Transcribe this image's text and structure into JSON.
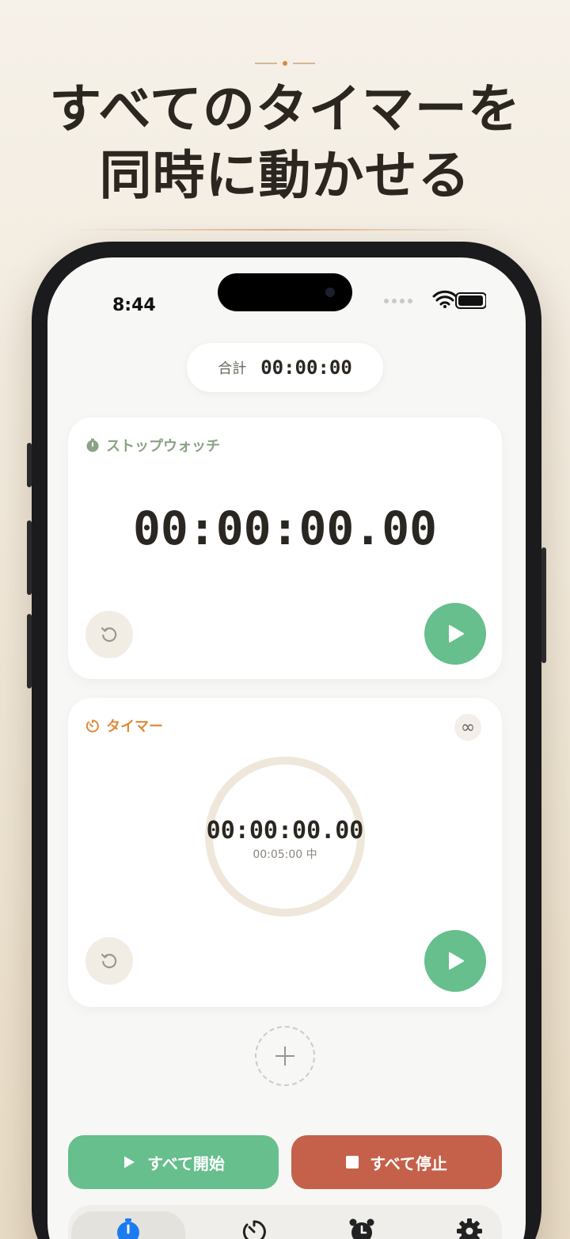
{
  "marketing": {
    "headline_line1": "すべてのタイマーを",
    "headline_line2": "同時に動かせる"
  },
  "status_bar": {
    "time": "8:44"
  },
  "total": {
    "label": "合計",
    "value": "00:00:00"
  },
  "stopwatch_card": {
    "title": "ストップウォッチ",
    "time": "00:00:00.00",
    "icon": "stopwatch-icon"
  },
  "timer_card": {
    "title": "タイマー",
    "time": "00:00:00.00",
    "subtitle": "00:05:00 中",
    "loop_symbol": "∞",
    "progress": 0,
    "icon": "timer-icon"
  },
  "actions": {
    "start_all": "すべて開始",
    "stop_all": "すべて停止"
  },
  "tabs": [
    {
      "icon": "stopwatch-icon",
      "active": true
    },
    {
      "icon": "timer-icon",
      "active": false
    },
    {
      "icon": "alarm-clock-icon",
      "active": false
    },
    {
      "icon": "gear-icon",
      "active": false
    }
  ],
  "colors": {
    "accent_green": "#66bf8c",
    "accent_red": "#c5614a",
    "timer_orange": "#e08a3c",
    "stopwatch_green": "#8aa285",
    "tab_active_blue": "#1a7cf0"
  }
}
